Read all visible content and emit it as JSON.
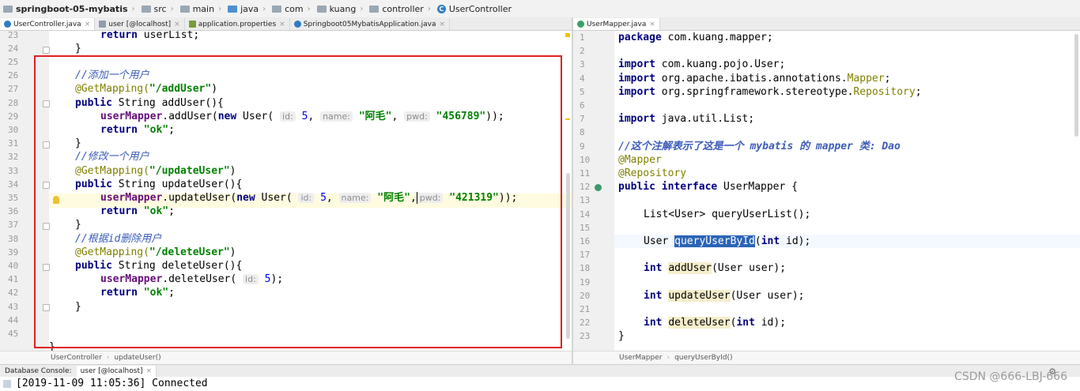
{
  "breadcrumb": [
    {
      "label": "springboot-05-mybatis",
      "type": "project"
    },
    {
      "label": "src",
      "type": "folder"
    },
    {
      "label": "main",
      "type": "folder"
    },
    {
      "label": "java",
      "type": "folder"
    },
    {
      "label": "com",
      "type": "folder"
    },
    {
      "label": "kuang",
      "type": "folder"
    },
    {
      "label": "controller",
      "type": "folder"
    },
    {
      "label": "UserController",
      "type": "class"
    }
  ],
  "left_tabs": [
    {
      "label": "UserController.java",
      "icon": "class-icon",
      "active": true
    },
    {
      "label": "user [@localhost]",
      "icon": "table-icon",
      "active": false
    },
    {
      "label": "application.properties",
      "icon": "properties-icon",
      "active": false
    },
    {
      "label": "Springboot05MybatisApplication.java",
      "icon": "class-icon",
      "active": false
    }
  ],
  "right_tabs": [
    {
      "label": "UserMapper.java",
      "icon": "interface-icon",
      "active": true
    }
  ],
  "left_editor": {
    "line_numbers": [
      "23",
      "24",
      "25",
      "26",
      "27",
      "28",
      "29",
      "30",
      "31",
      "32",
      "33",
      "34",
      "35",
      "36",
      "37",
      "38",
      "39",
      "40",
      "41",
      "42",
      "43",
      "44",
      "45"
    ],
    "code": {
      "l23_kw": "return",
      "l23_rest": " userList;",
      "l24": "}",
      "l26": "//添加一个用户",
      "l27_ann": "@GetMapping(",
      "l27_str": "\"/addUser\"",
      "l27_end": ")",
      "l28_kw": "public",
      "l28_rest": " String addUser(){",
      "l29_fld": "userMapper",
      "l29_a": ".addUser(",
      "l29_kw": "new",
      "l29_b": " User( ",
      "l29_h1": "id:",
      "l29_v1": "5",
      "l29_c": ", ",
      "l29_h2": "name:",
      "l29_v2": "\"阿毛\"",
      "l29_d": ", ",
      "l29_h3": "pwd:",
      "l29_v3": "\"456789\"",
      "l29_e": "));",
      "l30_kw": "return",
      "l30_str": "\"ok\"",
      "l30_end": ";",
      "l31": "}",
      "l32": "//修改一个用户",
      "l33_ann": "@GetMapping(",
      "l33_str": "\"/updateUser\"",
      "l33_end": ")",
      "l34_kw": "public",
      "l34_rest": " String updateUser(){",
      "l35_fld": "userMapper",
      "l35_a": ".updateUser(",
      "l35_kw": "new",
      "l35_b": " User( ",
      "l35_h1": "id:",
      "l35_v1": "5",
      "l35_c": ", ",
      "l35_h2": "name:",
      "l35_v2": "\"阿毛\"",
      "l35_d": ",",
      "l35_h3": "pwd:",
      "l35_v3": "\"421319\"",
      "l35_e": "));",
      "l36_kw": "return",
      "l36_str": "\"ok\"",
      "l36_end": ";",
      "l37": "}",
      "l38": "//根据id删除用户",
      "l39_ann": "@GetMapping(",
      "l39_str": "\"/deleteUser\"",
      "l39_end": ")",
      "l40_kw": "public",
      "l40_rest": " String deleteUser(){",
      "l41_fld": "userMapper",
      "l41_a": ".deleteUser( ",
      "l41_h1": "id:",
      "l41_v1": "5",
      "l41_e": ");",
      "l42_kw": "return",
      "l42_str": "\"ok\"",
      "l42_end": ";",
      "l43": "}",
      "l45": "}"
    },
    "status": [
      "UserController",
      "updateUser()"
    ]
  },
  "right_editor": {
    "line_numbers": [
      "1",
      "2",
      "3",
      "4",
      "5",
      "6",
      "7",
      "8",
      "9",
      "10",
      "11",
      "12",
      "13",
      "14",
      "15",
      "16",
      "17",
      "18",
      "19",
      "20",
      "21",
      "22",
      "23"
    ],
    "code": {
      "r1_kw": "package",
      "r1_rest": " com.kuang.mapper;",
      "r3_kw": "import",
      "r3_rest": " com.kuang.pojo.User;",
      "r4_kw": "import",
      "r4_a": " org.apache.ibatis.annotations.",
      "r4_ann": "Mapper",
      "r4_e": ";",
      "r5_kw": "import",
      "r5_a": " org.springframework.stereotype.",
      "r5_ann": "Repository",
      "r5_e": ";",
      "r7_kw": "import",
      "r7_rest": " java.util.List;",
      "r9": "//这个注解表示了这是一个 mybatis 的 mapper 类: Dao",
      "r10": "@Mapper",
      "r11": "@Repository",
      "r12_kw": "public interface",
      "r12_rest": " UserMapper {",
      "r14": "List<User> queryUserList();",
      "r16_a": "User ",
      "r16_sel": "queryUserById",
      "r16_b": "(",
      "r16_kw": "int",
      "r16_c": " id);",
      "r18_kw": "int",
      "r18_m": "addUser",
      "r18_rest": "(User user);",
      "r20_kw": "int",
      "r20_m": "updateUser",
      "r20_rest": "(User user);",
      "r22_kw": "int",
      "r22_m": "deleteUser",
      "r22_b": "(",
      "r22_kw2": "int",
      "r22_c": " id);",
      "r23": "}"
    },
    "status": [
      "UserMapper",
      "queryUserById()"
    ]
  },
  "console": {
    "tab_label": "Database Console:",
    "session": "user [@localhost]",
    "output": "[2019-11-09 11:05:36] Connected",
    "watermark": "CSDN @666-LBJ-666"
  },
  "colors": {
    "highlight_box": "#e02020",
    "keyword": "#000080",
    "string": "#008000",
    "annotation": "#808000",
    "comment": "#3b5cb8",
    "field": "#660e7a"
  }
}
